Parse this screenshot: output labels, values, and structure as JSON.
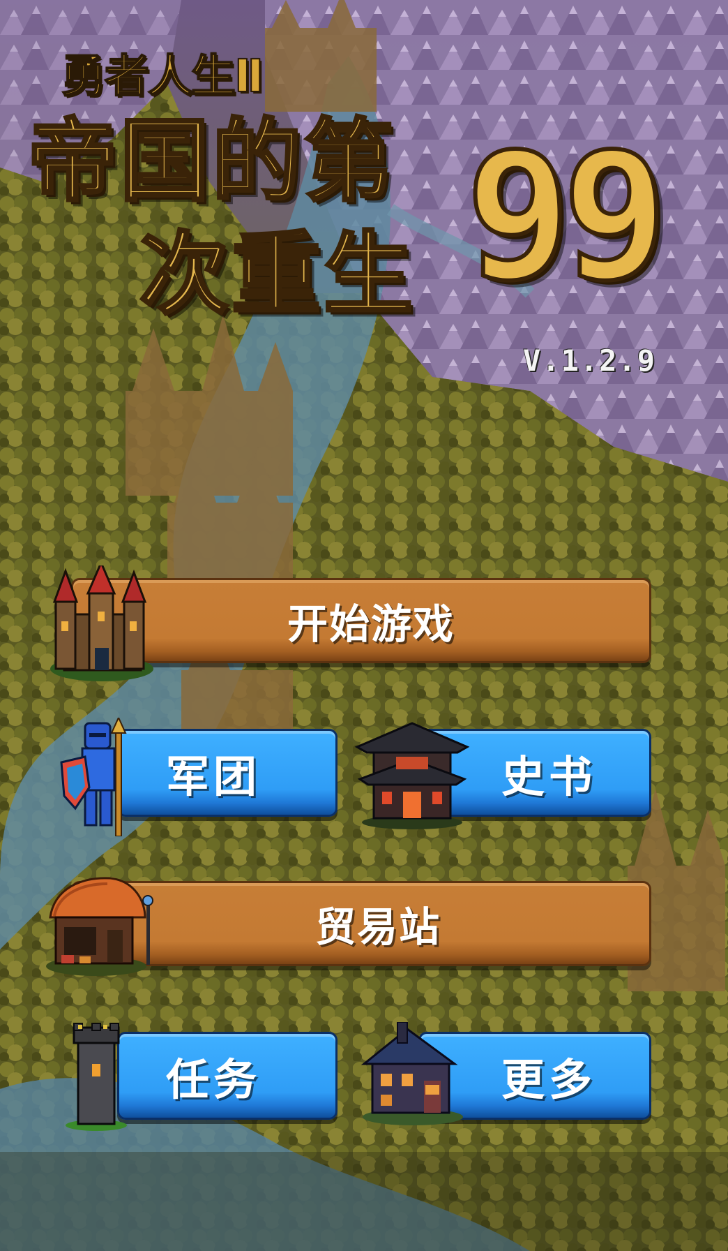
{
  "title": {
    "subtitle": "勇者人生Ⅱ",
    "line1": "帝国的第",
    "line2": "次重生",
    "number": "99",
    "version": "V.1.2.9"
  },
  "menu": {
    "start": "开始游戏",
    "legion": "军团",
    "history": "史书",
    "trade": "贸易站",
    "quest": "任务",
    "more": "更多"
  },
  "icons": {
    "start": "castle-icon",
    "legion": "knight-icon",
    "history": "pagoda-icon",
    "trade": "market-hut-icon",
    "quest": "watchtower-icon",
    "more": "house-icon"
  },
  "colors": {
    "wood_button": "#c47a33",
    "blue_button": "#2f9df6",
    "title_gold": "#e3b64d",
    "version_text": "#f4f4f4"
  }
}
